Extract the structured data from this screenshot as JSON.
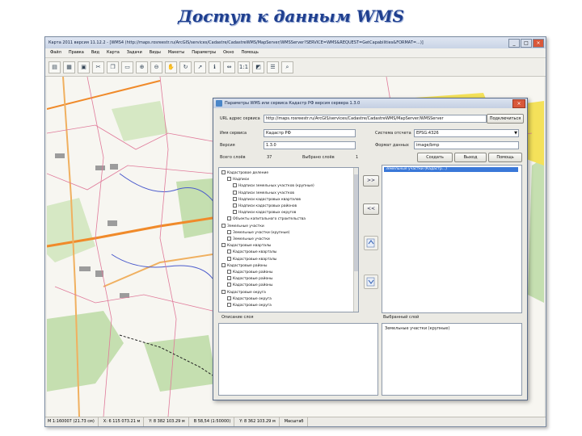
{
  "slide_title": "Доступ к данным WMS",
  "app": {
    "title": "Карта 2011 версия 11.12.2 - [WMS4 (http://maps.rosreestr.ru/ArcGIS/services/Cadastre/CadastreWMS/MapServer/WMSServer?SERVICE=WMS&REQUEST=GetCapabilities&FORMAT=...)]",
    "menu": [
      "Файл",
      "Правка",
      "Вид",
      "Карта",
      "Задачи",
      "Виды",
      "Макеты",
      "Параметры",
      "Окно",
      "Помощь"
    ],
    "toolbar_icons": [
      "open-icon",
      "save-icon",
      "print-icon",
      "cut-icon",
      "copy-icon",
      "paste-icon",
      "zoom-in-icon",
      "zoom-out-icon",
      "hand-icon",
      "refresh-icon",
      "select-icon",
      "info-icon",
      "measure-icon",
      "scale-icon",
      "layers-icon",
      "legend-icon",
      "search-icon"
    ],
    "toolbar_glyphs": [
      "▤",
      "▦",
      "▣",
      "✂",
      "❐",
      "▭",
      "⊕",
      "⊖",
      "✋",
      "↻",
      "➚",
      "ℹ",
      "⇔",
      "1:1",
      "◩",
      "☰",
      "⌕"
    ],
    "status": [
      "М 1:160007 (21.73 см)",
      "X: 6 115 073.21 м",
      "Y: 8 382 103.29 м",
      "В 58,54 (1:50000)",
      "Y: 8 362 103.29 м",
      "Масштаб"
    ]
  },
  "dialog": {
    "title": "Параметры WMS или сервиса Кадастр РФ версия сервера 1.3.0",
    "url_label": "URL адрес сервиса",
    "url_value": "http://maps.rosreestr.ru/ArcGIS/services/Cadastre/CadastreWMS/MapServer/WMSServer",
    "connect_button": "Подключиться",
    "service_name_label": "Имя сервиса",
    "service_name_value": "Кадастр РФ",
    "version_label": "Версия",
    "version_value": "1.3.0",
    "crs_label": "Система отсчета",
    "crs_value": "EPSG:4326",
    "format_label": "Формат данных",
    "format_value": "image/bmp",
    "layers_total_label": "Всего слоёв",
    "layers_total_value": "37",
    "layers_selected_label": "Выбрано слоёв",
    "layers_selected_value": "1",
    "buttons": {
      "create": "Создать",
      "exit": "Выход",
      "help": "Помощь"
    },
    "add_button": ">>",
    "remove_button": "<<",
    "selected_item": "Земельные участки (Кадастр...)",
    "tree": [
      "Кадастровое деление",
      "Надписи",
      "Надписи земельных участков (крупные)",
      "Надписи земельных участков",
      "Надписи кадастровых кварталов",
      "Надписи кадастровых районов",
      "Надписи кадастровых округов",
      "Объекты капитального строительства",
      "Земельные участки",
      "Земельные участки (крупные)",
      "Земельные участки",
      "Кадастровые кварталы",
      "Кадастровые кварталы",
      "Кадастровые кварталы",
      "Кадастровые районы",
      "Кадастровые районы",
      "Кадастровые районы",
      "Кадастровые районы",
      "Кадастровые округа",
      "Кадастровые округа",
      "Кадастровые округа"
    ],
    "layer_description_label": "Описание слоя",
    "selected_layer_label": "Выбранный слой",
    "selected_layer_text": "Земельные участки (крупные)"
  },
  "colors": {
    "slide_title": "#1f3f8f",
    "selection": "#3a78d8",
    "map_road": "#f08a2a",
    "map_forest": "#c5dfb0",
    "map_urban": "#f4e15a"
  }
}
